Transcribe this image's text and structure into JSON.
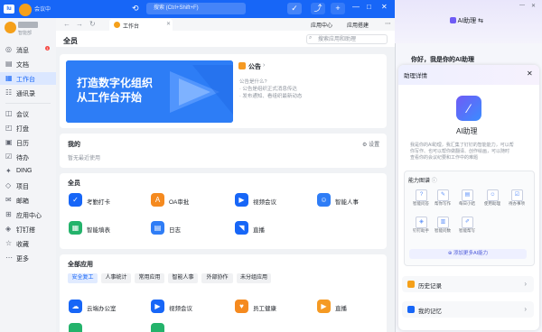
{
  "topbar": {
    "logo": "lu",
    "status": "会议中",
    "search_placeholder": "搜索 (Ctrl+Shift+F)",
    "history_icon": "clock-icon",
    "buttons": [
      "✓",
      "⤴",
      "+"
    ],
    "win_controls": [
      "—",
      "□",
      "✕"
    ]
  },
  "profile": {
    "org": "智能部"
  },
  "sidebar": {
    "items": [
      {
        "label": "消息",
        "icon": "◎",
        "badge": "1"
      },
      {
        "label": "文档",
        "icon": "▤"
      },
      {
        "label": "工作台",
        "icon": "▦"
      },
      {
        "label": "通讯录",
        "icon": "☷"
      },
      {
        "label": "会议",
        "icon": "◫"
      },
      {
        "label": "打盘",
        "icon": "◰"
      },
      {
        "label": "日历",
        "icon": "▣"
      },
      {
        "label": "待办",
        "icon": "☑"
      },
      {
        "label": "DING",
        "icon": "✦"
      },
      {
        "label": "项目",
        "icon": "◇"
      },
      {
        "label": "邮箱",
        "icon": "✉"
      },
      {
        "label": "应用中心",
        "icon": "⊞"
      },
      {
        "label": "钉钉搭",
        "icon": "◈"
      },
      {
        "label": "收藏",
        "icon": "☆"
      },
      {
        "label": "更多",
        "icon": "⋯"
      }
    ]
  },
  "tabs": {
    "tab_label": "工作台",
    "right_links": [
      "应用中心",
      "应用搭建"
    ]
  },
  "main": {
    "title": "全员",
    "search_placeholder": "搜索应用和助理",
    "banner": {
      "line1": "打造数字化组织",
      "line2": "从工作台开始"
    },
    "notice": {
      "title": "公告",
      "lines": [
        "公告是什么?",
        "· 公告是组织正式消息传达",
        "· 发布通知、看组织最新动态"
      ]
    },
    "mine": {
      "title": "我的",
      "settings": "设置",
      "empty": "暂无最近使用"
    },
    "all": {
      "title": "全员",
      "apps": [
        {
          "label": "考勤打卡",
          "color": "#1766f7",
          "icon": "✓"
        },
        {
          "label": "OA审批",
          "color": "#f58a1f",
          "icon": "A"
        },
        {
          "label": "视频会议",
          "color": "#1766f7",
          "icon": "▶"
        },
        {
          "label": "智能人事",
          "color": "#2f7df6",
          "icon": "☺"
        },
        {
          "label": "智能填表",
          "color": "#24b36b",
          "icon": "▦"
        },
        {
          "label": "日志",
          "color": "#2f7df6",
          "icon": "▤"
        },
        {
          "label": "直播",
          "color": "#1766f7",
          "icon": "◥"
        }
      ]
    },
    "apps_section": {
      "title": "全部应用",
      "chips": [
        "安全复工",
        "人事统计",
        "常用应用",
        "智能人事",
        "外部协作",
        "未分组应用"
      ],
      "apps": [
        {
          "label": "云端办公室",
          "color": "#1766f7",
          "icon": "☁"
        },
        {
          "label": "视频会议",
          "color": "#1766f7",
          "icon": "▶"
        },
        {
          "label": "员工健康",
          "color": "#f58a1f",
          "icon": "♥"
        },
        {
          "label": "直播",
          "color": "#f59a23",
          "icon": "▶"
        }
      ]
    }
  },
  "assistant": {
    "header": "AI助理",
    "greeting": "你好，我是你的AI助理",
    "panel_title": "助理详情",
    "name": "AI助理",
    "desc": [
      "我是你的AI助理，我汇集了钉钉的智能能力，可以帮",
      "你写作、也可以帮你做翻译、创作绘画，可以随时",
      "查看你的会议纪要和工作中的难题"
    ],
    "ability_title": "能力图谱",
    "abilities": [
      {
        "label": "智能问答",
        "icon": "?"
      },
      {
        "label": "帮你写作",
        "icon": "✎"
      },
      {
        "label": "每日小结",
        "icon": "▤"
      },
      {
        "label": "使用助理",
        "icon": "☺"
      },
      {
        "label": "待办事项",
        "icon": "☑"
      },
      {
        "label": "钉钉助手",
        "icon": "◈"
      },
      {
        "label": "智能问数",
        "icon": "▥"
      },
      {
        "label": "智能帮写",
        "icon": "✐"
      }
    ],
    "add_ability": "⊕ 添加更多AI能力",
    "rows": [
      {
        "label": "历史记录",
        "color": "#f5a01a"
      },
      {
        "label": "我的记忆",
        "color": "#1766f7"
      }
    ]
  }
}
